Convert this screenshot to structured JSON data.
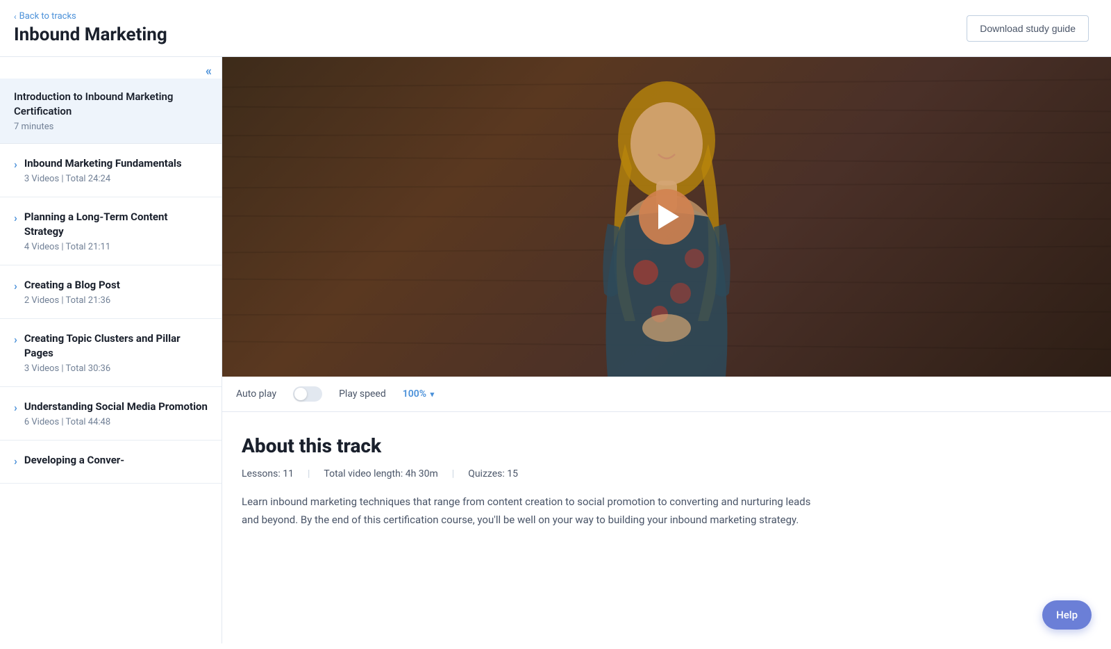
{
  "header": {
    "back_link": "Back to tracks",
    "page_title": "Inbound Marketing",
    "download_btn": "Download study guide"
  },
  "sidebar": {
    "collapse_icon": "«",
    "active_item": {
      "title": "Introduction to Inbound Marketing Certification",
      "meta": "7 minutes"
    },
    "items": [
      {
        "title": "Inbound Marketing Fundamentals",
        "meta": "3 Videos | Total 24:24"
      },
      {
        "title": "Planning a Long-Term Content Strategy",
        "meta": "4 Videos | Total 21:11"
      },
      {
        "title": "Creating a Blog Post",
        "meta": "2 Videos | Total 21:36"
      },
      {
        "title": "Creating Topic Clusters and Pillar Pages",
        "meta": "3 Videos | Total 30:36"
      },
      {
        "title": "Understanding Social Media Promotion",
        "meta": "6 Videos | Total 44:48"
      },
      {
        "title": "Developing a Conver-",
        "meta": ""
      }
    ]
  },
  "video": {
    "autoplay_label": "Auto play",
    "play_speed_label": "Play speed",
    "play_speed_value": "100%"
  },
  "about": {
    "title": "About this track",
    "lessons_label": "Lessons:",
    "lessons_value": "11",
    "total_video_label": "Total video length:",
    "total_video_value": "4h 30m",
    "quizzes_label": "Quizzes:",
    "quizzes_value": "15",
    "description": "Learn inbound marketing techniques that range from content creation to social promotion to converting and nurturing leads and beyond. By the end of this certification course, you'll be well on your way to building your inbound marketing strategy."
  },
  "help": {
    "label": "Help"
  }
}
